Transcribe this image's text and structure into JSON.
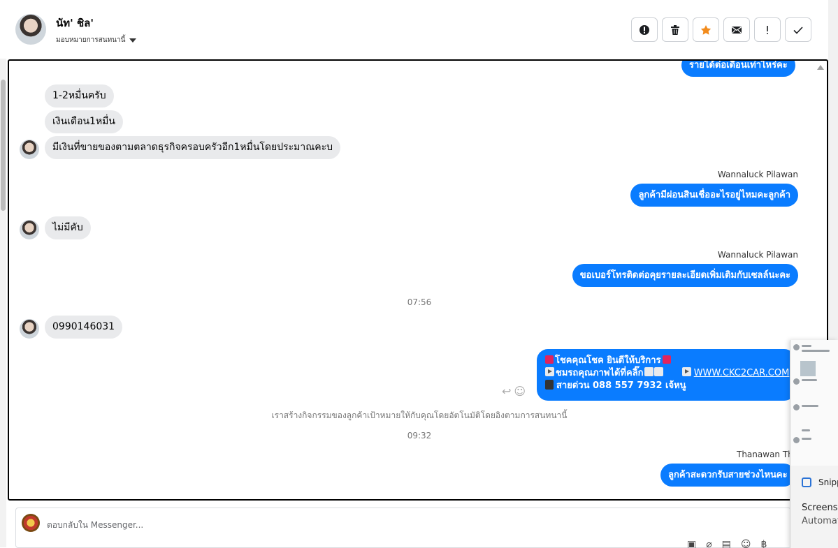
{
  "header": {
    "contact_name": "นัท' ชิล'",
    "assign_label": "มอบหมายการสนทนานี้",
    "actions": [
      {
        "icon": "alert-circle-icon"
      },
      {
        "icon": "trash-icon"
      },
      {
        "icon": "star-icon"
      },
      {
        "icon": "envelope-icon"
      },
      {
        "icon": "exclamation-icon"
      },
      {
        "icon": "check-icon"
      }
    ],
    "star_color": "#f28b1c"
  },
  "conversation": {
    "top_partial_outgoing": "รายได้ต่อเดือนเท่าไหร่คะ",
    "incoming_group_1": [
      "1-2หมื่นครับ",
      "เงินเดือน1หมื่น",
      "มีเงินที่ขายของตามตลาดธุรกิจครอบครัวอีก1หมื่นโดยประมาณคะบ"
    ],
    "out_1": {
      "sender": "Wannaluck Pilawan",
      "text": "ลูกค้ามีผ่อนสินเชื่ออะไรอยู่ไหมคะลูกค้า"
    },
    "incoming_2": "ไม่มีคับ",
    "out_2": {
      "sender": "Wannaluck Pilawan",
      "text": "ขอเบอร์โทรติดต่อคุยรายละเอียดเพิ่มเติมกับเซลล์นะคะ"
    },
    "time_1": "07:56",
    "incoming_3": "0990146031",
    "promo": {
      "line1": "โชคคุณโชค ยินดีให้บริการ",
      "line2": "ชมรถคุณภาพได้ที่คลิ๊ก",
      "link": "WWW.CKC2CAR.COM",
      "line3": "สายด่วน 088 557 7932 เจ้หนู"
    },
    "system_notice": "เราสร้างกิจกรรมของลูกค้าเป้าหมายให้กับคุณโดยอัตโนมัติโดยอิงตามการสนทนานี้",
    "time_2": "09:32",
    "out_3": {
      "sender": "Thanawan Tho",
      "text": "ลูกค้าสะดวกรับสายช่วงไหนคะ"
    },
    "accent_color": "#0a7cff"
  },
  "composer": {
    "placeholder": "ตอบกลับใน Messenger..."
  },
  "popup": {
    "title": "Snipp",
    "line1": "Screensh",
    "line2": "Automat"
  }
}
